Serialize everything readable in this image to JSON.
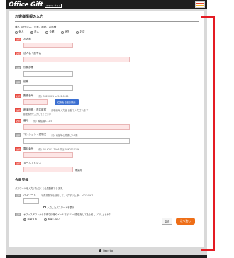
{
  "header": {
    "logo": "Office Gift",
    "logo_sub": "スマートサイト"
  },
  "form": {
    "title": "お客様情報の入力",
    "type_label": "購入 区分 法人、企業、病院、お店様",
    "type_options": [
      "個人",
      "法人",
      "企業",
      "病院",
      "お店"
    ],
    "selected_type": "法人",
    "required_tag": "必須",
    "optional_tag": "任意",
    "fields": {
      "name": "お名前",
      "company": "法人名・屋号名",
      "department": "所属部署",
      "position": "役職",
      "postal": "郵便番号",
      "postal_hint": "例）542-0081 or 542-0081",
      "postal_button": "住所を自動で検索",
      "prefecture": "都道府県・市区町村",
      "prefecture_hint": "郵便番号入力後 自動で入力されます",
      "prefecture_note": "郵便番号を入力してください",
      "address": "番地",
      "address_hint": "例）南船場3-12-9",
      "building": "マンション・建物名",
      "building_hint": "例）南船場心斎橋ビル3階",
      "phone": "電話番号",
      "phone_hint": "例）06-6251-7166 又は 0662517166",
      "email": "メールアドレス",
      "email_confirm": "確認用"
    },
    "member": {
      "title": "会員登録",
      "desc": "パスワードを入力いただくと会員登録できます。",
      "password_label": "パスワード",
      "password_hint": "半角英数字を使用して、4文字以上 例：a1234567",
      "show_password": "入力したパスワードを表示",
      "newsletter": "オフィスギフトからお得な情報やメールマガジンの配信をしてもよろしいでしょうか？",
      "newsletter_options": [
        "希望する",
        "希望しない"
      ],
      "newsletter_selected": "希望する"
    },
    "actions": {
      "back": "戻る",
      "next": "次へ進む"
    }
  },
  "footer": {
    "page_top": "Page top"
  },
  "colors": {
    "accent_red": "#e41b23",
    "required_red": "#e8493f",
    "next_orange": "#ee6e17",
    "search_blue": "#3b6fd1"
  }
}
